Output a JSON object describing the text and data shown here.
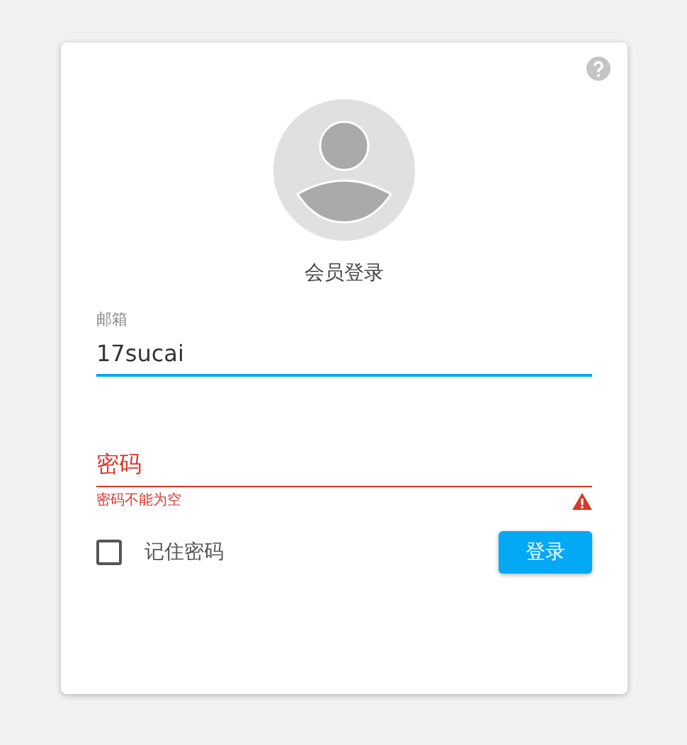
{
  "title": "会员登录",
  "fields": [
    {
      "label": "邮箱",
      "value": "17sucai",
      "focused": true
    },
    {
      "placeholder": "密码",
      "focused": false,
      "error": "密码不能为空"
    }
  ],
  "remember": {
    "label": "记住密码",
    "checked": false
  },
  "button": "登录"
}
